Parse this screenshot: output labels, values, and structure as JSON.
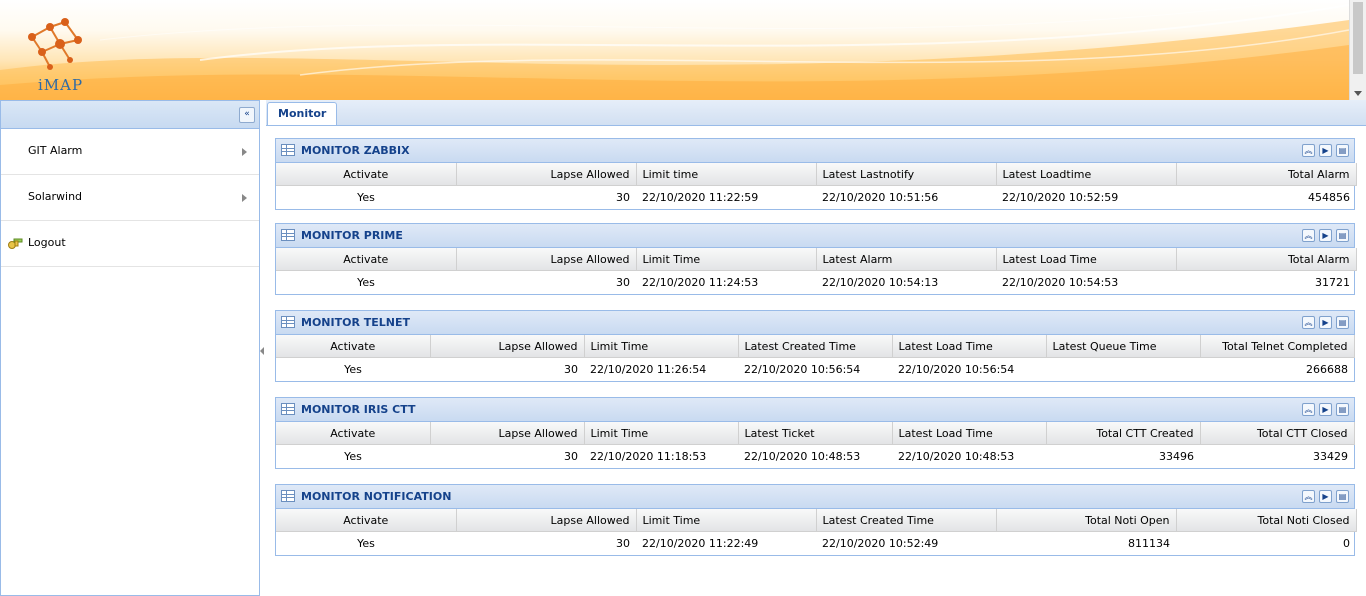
{
  "app": {
    "logo_text": "iMAP"
  },
  "sidebar": {
    "collapse_icon": "double-chevron-left-icon",
    "items": [
      {
        "label": "GIT Alarm",
        "icon": "chevron-right-icon"
      },
      {
        "label": "Solarwind",
        "icon": "chevron-right-icon"
      },
      {
        "label": "Logout",
        "icon": "logout-keys-icon"
      }
    ]
  },
  "main": {
    "tabs": [
      {
        "label": "Monitor",
        "active": true
      }
    ]
  },
  "panels": [
    {
      "title": "MONITOR ZABBIX",
      "columns": [
        "Activate",
        "Lapse Allowed",
        "Limit time",
        "Latest Lastnotify",
        "Latest Loadtime",
        "Total Alarm"
      ],
      "row": [
        "Yes",
        "30",
        "22/10/2020 11:22:59",
        "22/10/2020 10:51:56",
        "22/10/2020 10:52:59",
        "454856"
      ]
    },
    {
      "title": "MONITOR PRIME",
      "columns": [
        "Activate",
        "Lapse Allowed",
        "Limit Time",
        "Latest Alarm",
        "Latest Load Time",
        "Total Alarm"
      ],
      "row": [
        "Yes",
        "30",
        "22/10/2020 11:24:53",
        "22/10/2020 10:54:13",
        "22/10/2020 10:54:53",
        "31721"
      ]
    },
    {
      "title": "MONITOR TELNET",
      "columns": [
        "Activate",
        "Lapse Allowed",
        "Limit Time",
        "Latest Created Time",
        "Latest Load Time",
        "Latest Queue Time",
        "Total Telnet Completed"
      ],
      "row": [
        "Yes",
        "30",
        "22/10/2020 11:26:54",
        "22/10/2020 10:56:54",
        "22/10/2020 10:56:54",
        "",
        "266688"
      ]
    },
    {
      "title": "MONITOR IRIS CTT",
      "columns": [
        "Activate",
        "Lapse Allowed",
        "Limit Time",
        "Latest Ticket",
        "Latest Load Time",
        "Total CTT Created",
        "Total CTT Closed"
      ],
      "row": [
        "Yes",
        "30",
        "22/10/2020 11:18:53",
        "22/10/2020 10:48:53",
        "22/10/2020 10:48:53",
        "33496",
        "33429"
      ]
    },
    {
      "title": "MONITOR NOTIFICATION",
      "columns": [
        "Activate",
        "Lapse Allowed",
        "Limit Time",
        "Latest Created Time",
        "Total Noti Open",
        "Total Noti Closed"
      ],
      "row": [
        "Yes",
        "30",
        "22/10/2020 11:22:49",
        "22/10/2020 10:52:49",
        "811134",
        "0"
      ]
    }
  ],
  "colors": {
    "header_blue": "#15428b",
    "border_blue": "#99bbe8",
    "banner_orange": "#ffb347"
  }
}
